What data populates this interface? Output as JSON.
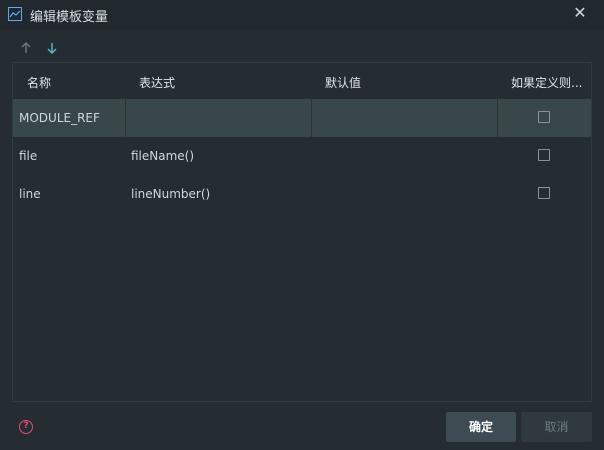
{
  "window": {
    "title": "编辑模板变量",
    "icons": {
      "app": "app-logo-icon",
      "close": "close-icon"
    }
  },
  "toolbar": {
    "icons": [
      "arrow-up-icon",
      "arrow-down-icon"
    ]
  },
  "table": {
    "headers": [
      "名称",
      "表达式",
      "默认值",
      "如果定义则..."
    ],
    "rows": [
      {
        "name": "MODULE_REF",
        "expression": "",
        "default": "",
        "skip_if_defined": false
      },
      {
        "name": "file",
        "expression": "fileName()",
        "default": "",
        "skip_if_defined": false
      },
      {
        "name": "line",
        "expression": "lineNumber()",
        "default": "",
        "skip_if_defined": false
      }
    ]
  },
  "footer": {
    "help_icon": "help-icon",
    "ok_label": "确定",
    "cancel_label": "取消"
  },
  "colors": {
    "background": "#252d33",
    "selected_row": "#37474a",
    "help_accent": "#e04f6a"
  }
}
